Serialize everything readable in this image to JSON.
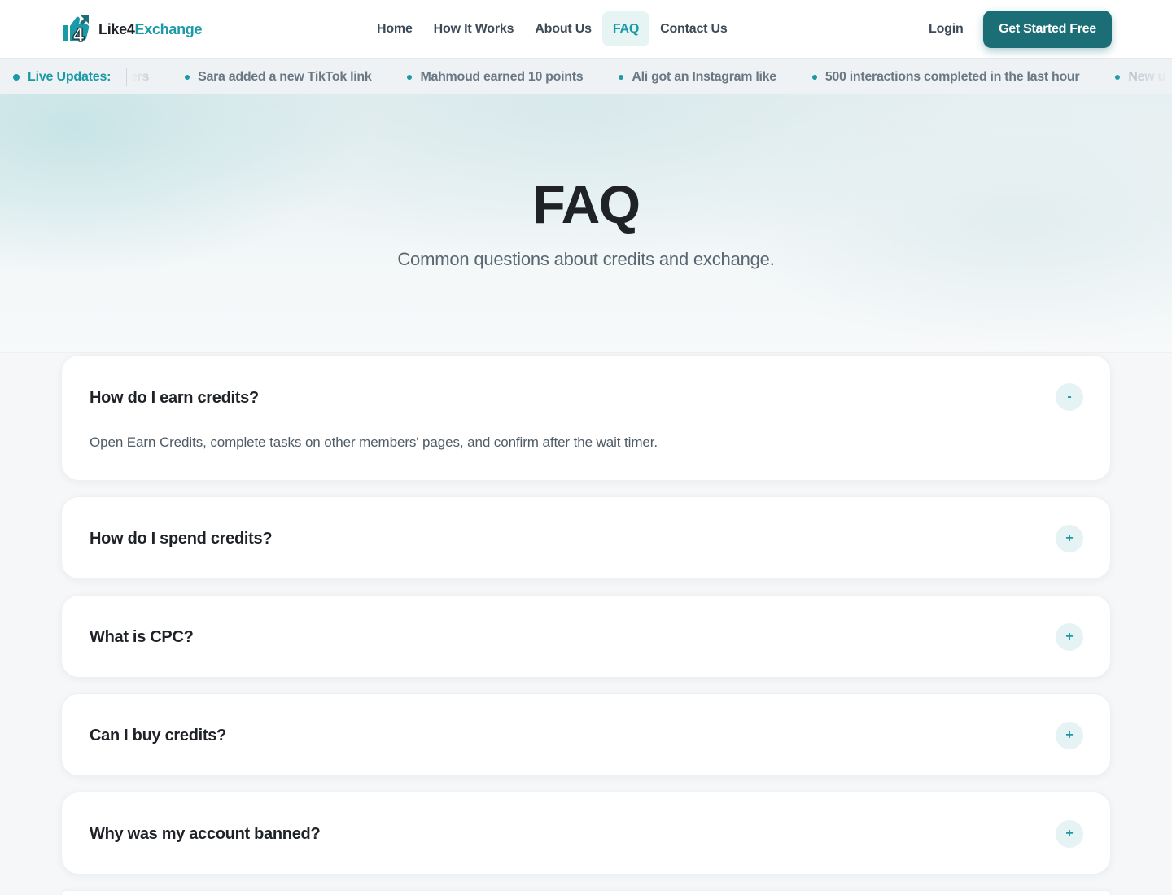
{
  "brand": {
    "name_part1": "Like4",
    "name_part2": "Exchange",
    "logo_glyph": "4"
  },
  "nav": {
    "items": [
      {
        "label": "Home",
        "active": false
      },
      {
        "label": "How It Works",
        "active": false
      },
      {
        "label": "About Us",
        "active": false
      },
      {
        "label": "FAQ",
        "active": true
      },
      {
        "label": "Contact Us",
        "active": false
      }
    ],
    "login_label": "Login",
    "cta_label": "Get Started Free"
  },
  "ticker": {
    "label": "Live Updates:",
    "items": [
      "ers",
      "Sara added a new TikTok link",
      "Mahmoud earned 10 points",
      "Ali got an Instagram like",
      "500 interactions completed in the last hour",
      "New u"
    ]
  },
  "hero": {
    "title": "FAQ",
    "subtitle": "Common questions about credits and exchange."
  },
  "faq": [
    {
      "question": "How do I earn credits?",
      "answer": "Open Earn Credits, complete tasks on other members' pages, and confirm after the wait timer.",
      "expanded": true,
      "toggle": "-"
    },
    {
      "question": "How do I spend credits?",
      "expanded": false,
      "toggle": "+"
    },
    {
      "question": "What is CPC?",
      "expanded": false,
      "toggle": "+"
    },
    {
      "question": "Can I buy credits?",
      "expanded": false,
      "toggle": "+"
    },
    {
      "question": "Why was my account banned?",
      "expanded": false,
      "toggle": "+"
    }
  ],
  "colors": {
    "accent": "#1a9aa6",
    "cta": "#1b6e75",
    "text": "#1f2328"
  }
}
